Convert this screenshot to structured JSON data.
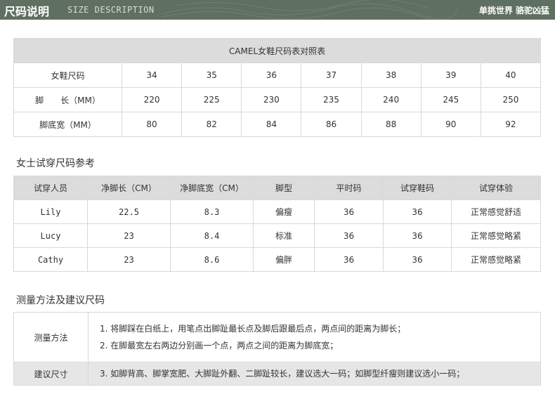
{
  "header": {
    "title": "尺码说明",
    "subtitle": "SIZE DESCRIPTION",
    "slogan": "单挑世界 骆驼凶猛"
  },
  "size_table": {
    "caption": "CAMEL女鞋尺码表对照表",
    "rows": [
      {
        "label": "女鞋尺码",
        "values": [
          "34",
          "35",
          "36",
          "37",
          "38",
          "39",
          "40"
        ]
      },
      {
        "label": "脚　　长（MM）",
        "values": [
          "220",
          "225",
          "230",
          "235",
          "240",
          "245",
          "250"
        ]
      },
      {
        "label": "脚底宽（MM）",
        "values": [
          "80",
          "82",
          "84",
          "86",
          "88",
          "90",
          "92"
        ]
      }
    ]
  },
  "trial_section": {
    "title": "女士试穿尺码参考",
    "headers": [
      "试穿人员",
      "净脚长（CM）",
      "净脚底宽（CM）",
      "脚型",
      "平时码",
      "试穿鞋码",
      "试穿体验"
    ],
    "rows": [
      [
        "Lily",
        "22.5",
        "8.3",
        "偏瘦",
        "36",
        "36",
        "正常感觉舒适"
      ],
      [
        "Lucy",
        "23",
        "8.4",
        "标准",
        "36",
        "36",
        "正常感觉略紧"
      ],
      [
        "Cathy",
        "23",
        "8.6",
        "偏胖",
        "36",
        "36",
        "正常感觉略紧"
      ]
    ]
  },
  "measure_section": {
    "title": "测量方法及建议尺码",
    "method_label": "测量方法",
    "method_lines": [
      "1. 将脚踩在白纸上，用笔点出脚趾最长点及脚后跟最后点，两点间的距离为脚长；",
      "2. 在脚最宽左右两边分别画一个点，两点之间的距离为脚底宽；"
    ],
    "advice_label": "建议尺寸",
    "advice_line": "3. 如脚背高、脚掌宽肥、大脚趾外翻、二脚趾较长，建议选大一码；如脚型纤瘦则建议选小一码；"
  },
  "colors": {
    "header_bg": "#5f7062",
    "table_header_bg": "#dcdcdc",
    "border": "#d9d9d9"
  }
}
